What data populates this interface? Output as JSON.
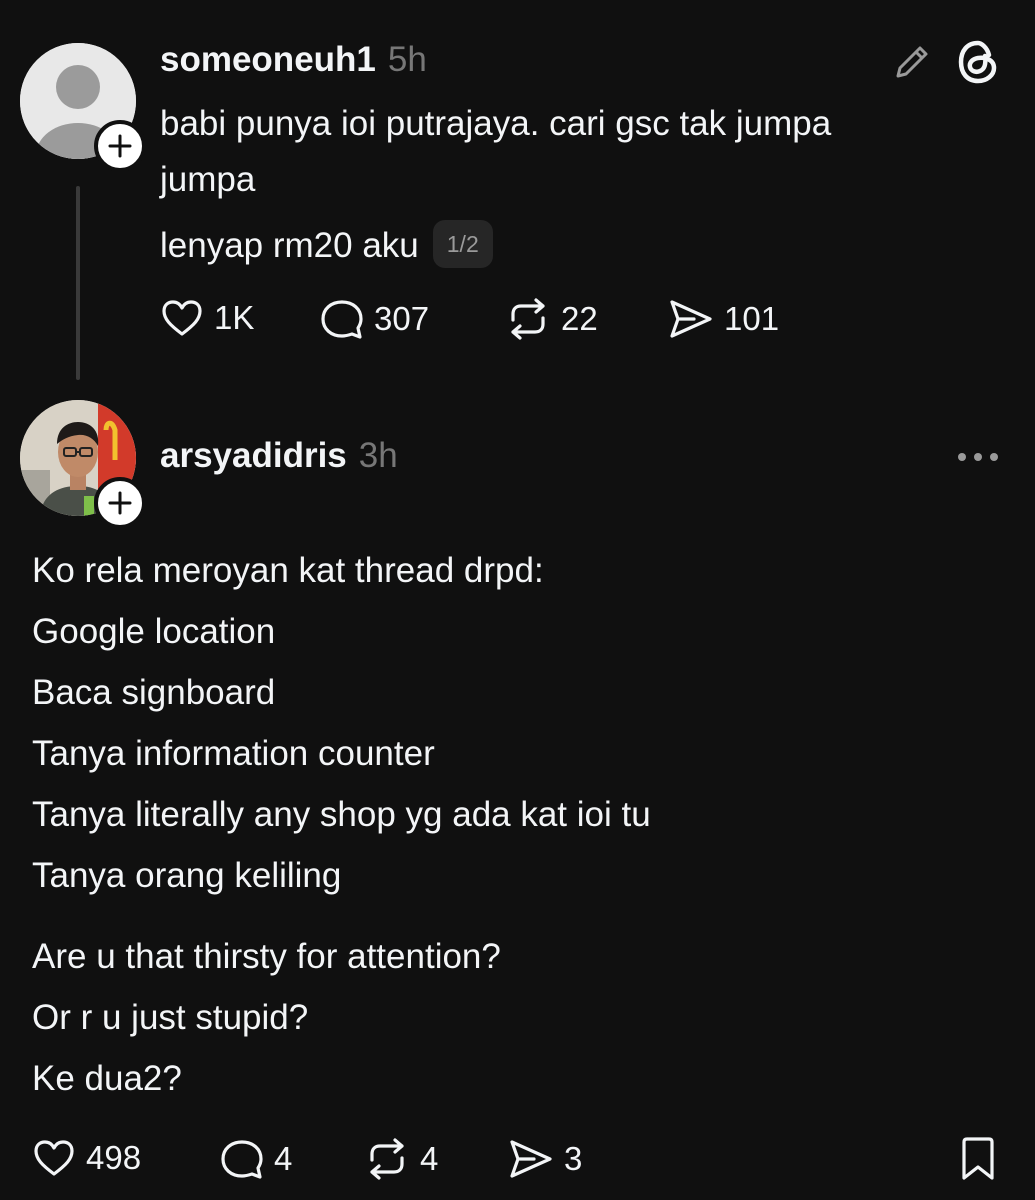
{
  "original_post": {
    "username": "someoneuh1",
    "timestamp": "5h",
    "text_lines": [
      "babi punya ioi putrajaya. cari gsc tak jumpa",
      "jumpa"
    ],
    "last_line": "lenyap rm20 aku",
    "page_indicator": "1/2",
    "likes": "1K",
    "comments": "307",
    "reposts": "22",
    "shares": "101"
  },
  "reply_post": {
    "username": "arsyadidris",
    "timestamp": "3h",
    "lines": [
      "Ko rela meroyan kat thread drpd:",
      "Google location",
      "Baca signboard",
      "Tanya information counter",
      "Tanya literally any shop yg ada kat ioi tu",
      "Tanya orang keliling"
    ],
    "lines_2": [
      "Are u that thirsty for attention?",
      "Or r u just stupid?",
      "Ke dua2?"
    ],
    "likes": "498",
    "comments": "4",
    "reposts": "4",
    "shares": "3"
  },
  "icons": {
    "edit": "pencil-icon",
    "app": "threads-logo-icon",
    "more": "more-options-icon",
    "bookmark": "bookmark-icon",
    "like": "heart-icon",
    "comment": "comment-icon",
    "repost": "repost-icon",
    "share": "share-icon",
    "follow": "plus-icon"
  },
  "colors": {
    "background": "#101010",
    "text": "#f3f5f7",
    "muted": "#777777",
    "badge_bg": "#262626"
  }
}
